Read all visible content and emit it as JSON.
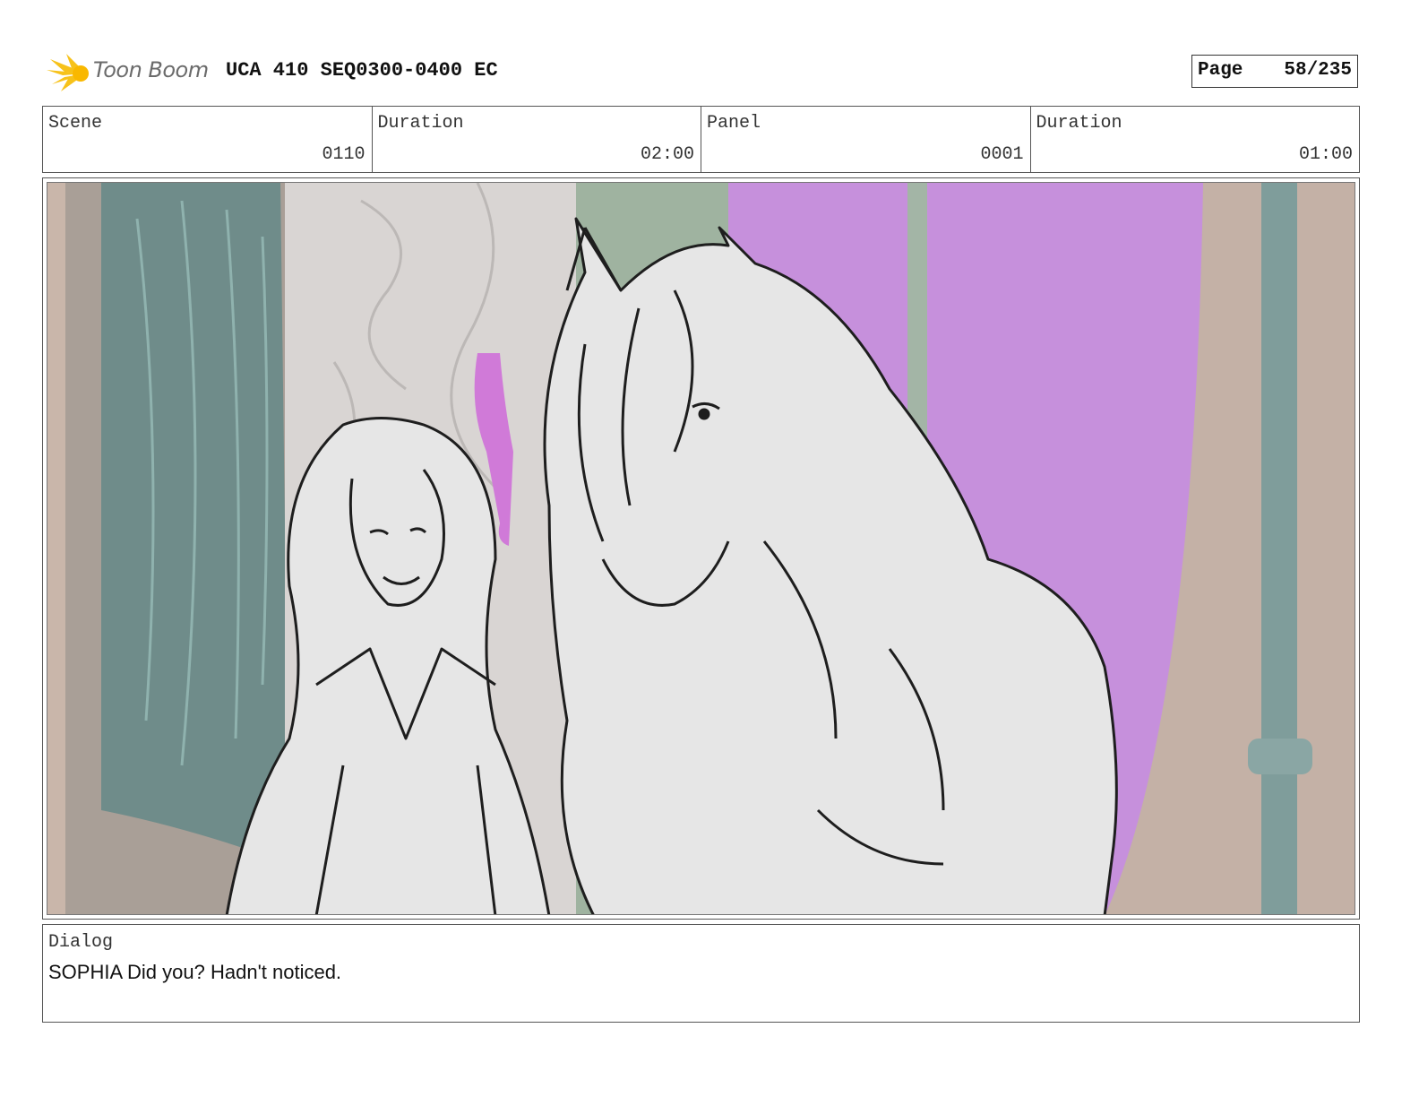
{
  "header": {
    "logo_text": "Toon Boom",
    "doc_title": "UCA 410 SEQ0300-0400 EC",
    "page_label": "Page",
    "page_number": "58/235"
  },
  "info": {
    "scene_label": "Scene",
    "scene_value": "0110",
    "scene_duration_label": "Duration",
    "scene_duration_value": "02:00",
    "panel_label": "Panel",
    "panel_value": "0001",
    "panel_duration_label": "Duration",
    "panel_duration_value": "01:00"
  },
  "dialog": {
    "label": "Dialog",
    "text": "SOPHIA Did you? Hadn't noticed."
  },
  "colors": {
    "accent_logo": "#f7c21a",
    "magenta_window": "#c690dc",
    "teal_curtain": "#6f8c8a",
    "green_arch": "#9fb3a0",
    "wall_tan": "#c9b6aa",
    "sketch_fill": "#e6e6e6"
  }
}
